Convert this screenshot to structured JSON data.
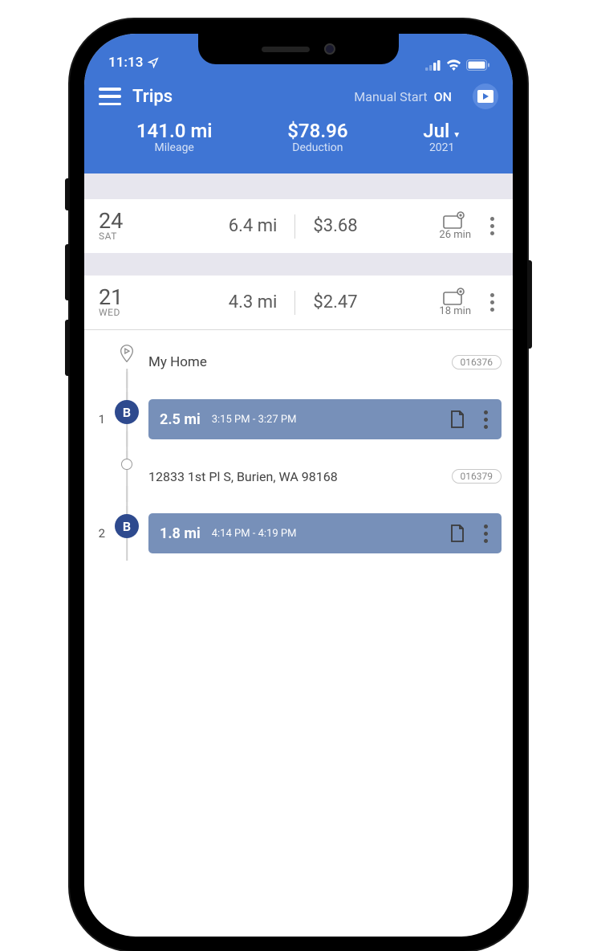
{
  "statusbar": {
    "time": "11:13"
  },
  "header": {
    "title": "Trips",
    "manual_start_label": "Manual Start",
    "manual_start_value": "ON",
    "mileage": {
      "value": "141.0 mi",
      "label": "Mileage"
    },
    "deduction": {
      "value": "$78.96",
      "label": "Deduction"
    },
    "month": {
      "value": "Jul",
      "year": "2021"
    }
  },
  "days": [
    {
      "num": "24",
      "dow": "SAT",
      "miles": "6.4 mi",
      "amount": "$3.68",
      "duration": "26 min"
    },
    {
      "num": "21",
      "dow": "WED",
      "miles": "4.3 mi",
      "amount": "$2.47",
      "duration": "18 min"
    }
  ],
  "timeline": {
    "start": {
      "label": "My Home",
      "id": "016376"
    },
    "trips": [
      {
        "idx": "1",
        "badge": "B",
        "dist": "2.5 mi",
        "times": "3:15 PM - 3:27 PM"
      }
    ],
    "stop1": {
      "label": "12833 1st Pl S, Burien, WA 98168",
      "id": "016379"
    },
    "trips2": [
      {
        "idx": "2",
        "badge": "B",
        "dist": "1.8 mi",
        "times": "4:14 PM - 4:19 PM"
      }
    ]
  }
}
